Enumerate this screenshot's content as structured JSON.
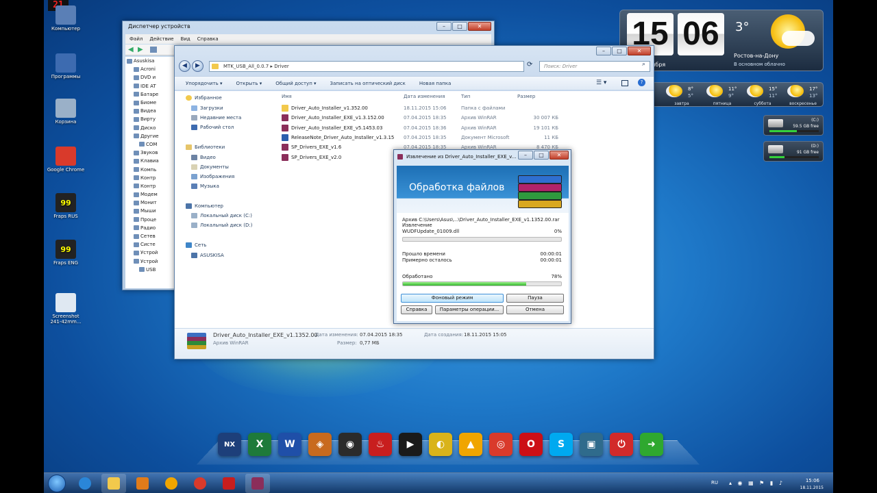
{
  "top_counter": "21",
  "desktop": {
    "icons": [
      {
        "label": "Компьютер"
      },
      {
        "label": "Программы"
      },
      {
        "label": "Корзина"
      },
      {
        "label": "Google Chrome"
      },
      {
        "label": "Fraps RUS"
      },
      {
        "label": "Fraps ENG"
      },
      {
        "label": "Screenshot 241-42mm..."
      }
    ]
  },
  "device_manager": {
    "title": "Диспетчер устройств",
    "menu": [
      "Файл",
      "Действие",
      "Вид",
      "Справка"
    ],
    "tree": [
      "Asuskisa",
      "Acroni",
      "DVD и",
      "IDE AT",
      "Батаре",
      "Биоме",
      "Видеа",
      "Вирту",
      "Диско",
      "Другие",
      "COM",
      "Звуков",
      "Клавиа",
      "Компь",
      "Контр",
      "Контр",
      "Модем",
      "Монит",
      "Мыши",
      "Проце",
      "Радио",
      "Сетев",
      "Систе",
      "Устрой",
      "Устрой",
      "USB"
    ]
  },
  "explorer": {
    "address": "MTK_USB_All_0.0.7  ▸  Driver",
    "search_placeholder": "Поиск: Driver",
    "commands": [
      "Упорядочить ▾",
      "Открыть ▾",
      "Общий доступ ▾",
      "Записать на оптический диск",
      "Новая папка"
    ],
    "nav": {
      "favorites": "Избранное",
      "downloads": "Загрузки",
      "recent": "Недавние места",
      "desktop": "Рабочий стол",
      "libraries": "Библиотеки",
      "video": "Видео",
      "documents": "Документы",
      "pictures": "Изображения",
      "music": "Музыка",
      "computer": "Компьютер",
      "drive_c": "Локальный диск (C:)",
      "drive_d": "Локальный диск (D:)",
      "network": "Сеть",
      "pc": "ASUSKISA"
    },
    "columns": {
      "name": "Имя",
      "date": "Дата изменения",
      "type": "Тип",
      "size": "Размер"
    },
    "files": [
      {
        "name": "Driver_Auto_Installer_v1.352.00",
        "date": "18.11.2015 15:06",
        "type": "Папка с файлами",
        "size": "",
        "color": "#f2c94c"
      },
      {
        "name": "Driver_Auto_Installer_EXE_v1.3.152.00",
        "date": "07.04.2015 18:35",
        "type": "Архив WinRAR",
        "size": "30 007 КБ",
        "color": "#8b2e5a"
      },
      {
        "name": "Driver_Auto_Installer_EXE_v5.1453.03",
        "date": "07.04.2015 18:36",
        "type": "Архив WinRAR",
        "size": "19 101 КБ",
        "color": "#8b2e5a"
      },
      {
        "name": "ReleaseNote_Driver_Auto_Installer_v1.3.15",
        "date": "07.04.2015 18:35",
        "type": "Документ Microsoft",
        "size": "11 КБ",
        "color": "#2b5fad"
      },
      {
        "name": "SP_Drivers_EXE_v1.6",
        "date": "07.04.2015 18:35",
        "type": "Архив WinRAR",
        "size": "8 470 КБ",
        "color": "#8b2e5a"
      },
      {
        "name": "SP_Drivers_EXE_v2.0",
        "date": "",
        "type": "",
        "size": "",
        "color": "#8b2e5a"
      }
    ],
    "details": {
      "name": "Driver_Auto_Installer_EXE_v1.1352.00",
      "type": "Архив WinRAR",
      "modified_label": "Дата изменения:",
      "modified": "07.04.2015 18:35",
      "created_label": "Дата создания:",
      "created": "18.11.2015 15:05",
      "size_label": "Размер:",
      "size": "0,77 МБ"
    }
  },
  "winrar": {
    "caption": "Извлечение из Driver_Auto_Installer_EXE_v...",
    "banner": "Обработка файлов",
    "archive_line": "Архив C:\\Users\\Asus\\...\\Driver_Auto_Installer_EXE_v1.1352.00.rar",
    "extracting_label": "Извлечение",
    "current_file": "WUDFUpdate_01009.dll",
    "file_percent": "0%",
    "file_progress": 0.0,
    "elapsed_label": "Прошло времени",
    "elapsed": "00:00:01",
    "remaining_label": "Примерно осталось",
    "remaining": "00:00:01",
    "processed_label": "Обработано",
    "processed_percent": "78%",
    "processed_progress": 0.78,
    "buttons": {
      "background": "Фоновый режим",
      "pause": "Пауза",
      "help": "Справка",
      "params": "Параметры операции...",
      "cancel": "Отмена"
    }
  },
  "clock_gadget": {
    "hours": "15",
    "minutes": "06",
    "date": "Ср, 18 ноября",
    "temperature": "3°",
    "city": "Ростов-на-Дону",
    "condition": "В основном облачно"
  },
  "forecast": [
    {
      "day": "сегодня",
      "hi": "4°",
      "lo": "1°"
    },
    {
      "day": "завтра",
      "hi": "8°",
      "lo": "5°"
    },
    {
      "day": "пятница",
      "hi": "11°",
      "lo": "9°"
    },
    {
      "day": "суббота",
      "hi": "15°",
      "lo": "11°"
    },
    {
      "day": "воскресенье",
      "hi": "17°",
      "lo": "13°"
    }
  ],
  "drives": [
    {
      "letter": "(C:)",
      "free": "59.5 GB free",
      "used_fraction": 0.55
    },
    {
      "letter": "(D:)",
      "free": "91 GB free",
      "used_fraction": 0.3
    }
  ],
  "dock": [
    {
      "icon": "nexus-icon",
      "glyph": "NX",
      "color": "#1d3f7a"
    },
    {
      "icon": "excel-icon",
      "glyph": "X",
      "color": "#1e7a3a"
    },
    {
      "icon": "word-icon",
      "glyph": "W",
      "color": "#1f4fa8"
    },
    {
      "icon": "eye-icon",
      "glyph": "◈",
      "color": "#c86a1e"
    },
    {
      "icon": "camera-icon",
      "glyph": "◉",
      "color": "#2b2b2b"
    },
    {
      "icon": "flame-icon",
      "glyph": "♨",
      "color": "#c81e1e"
    },
    {
      "icon": "media-player-icon",
      "glyph": "▶",
      "color": "#1a1a1a"
    },
    {
      "icon": "disc-icon",
      "glyph": "◐",
      "color": "#d9b31a"
    },
    {
      "icon": "aimp-icon",
      "glyph": "▲",
      "color": "#f0a500"
    },
    {
      "icon": "chrome-icon",
      "glyph": "◎",
      "color": "#d93a2b"
    },
    {
      "icon": "opera-icon",
      "glyph": "O",
      "color": "#cc0f16"
    },
    {
      "icon": "skype-icon",
      "glyph": "S",
      "color": "#00a9f0"
    },
    {
      "icon": "screenshot-icon",
      "glyph": "▣",
      "color": "#2f6b8c"
    },
    {
      "icon": "power-icon",
      "glyph": "⏻",
      "color": "#d22a2a"
    },
    {
      "icon": "exit-icon",
      "glyph": "➜",
      "color": "#2fa82f"
    }
  ],
  "taskbar": {
    "lang": "RU",
    "time": "15:06",
    "date": "18.11.2015",
    "items": [
      {
        "icon": "ie-icon",
        "color": "#2a86d8"
      },
      {
        "icon": "folder-icon",
        "color": "#f2c94c"
      },
      {
        "icon": "media-icon",
        "color": "#e07b1a"
      },
      {
        "icon": "aimp-icon",
        "color": "#f0a500"
      },
      {
        "icon": "chrome-icon",
        "color": "#d93a2b"
      },
      {
        "icon": "flag-icon",
        "color": "#c81e1e"
      },
      {
        "icon": "winrar-icon",
        "color": "#8b2e5a"
      }
    ]
  }
}
